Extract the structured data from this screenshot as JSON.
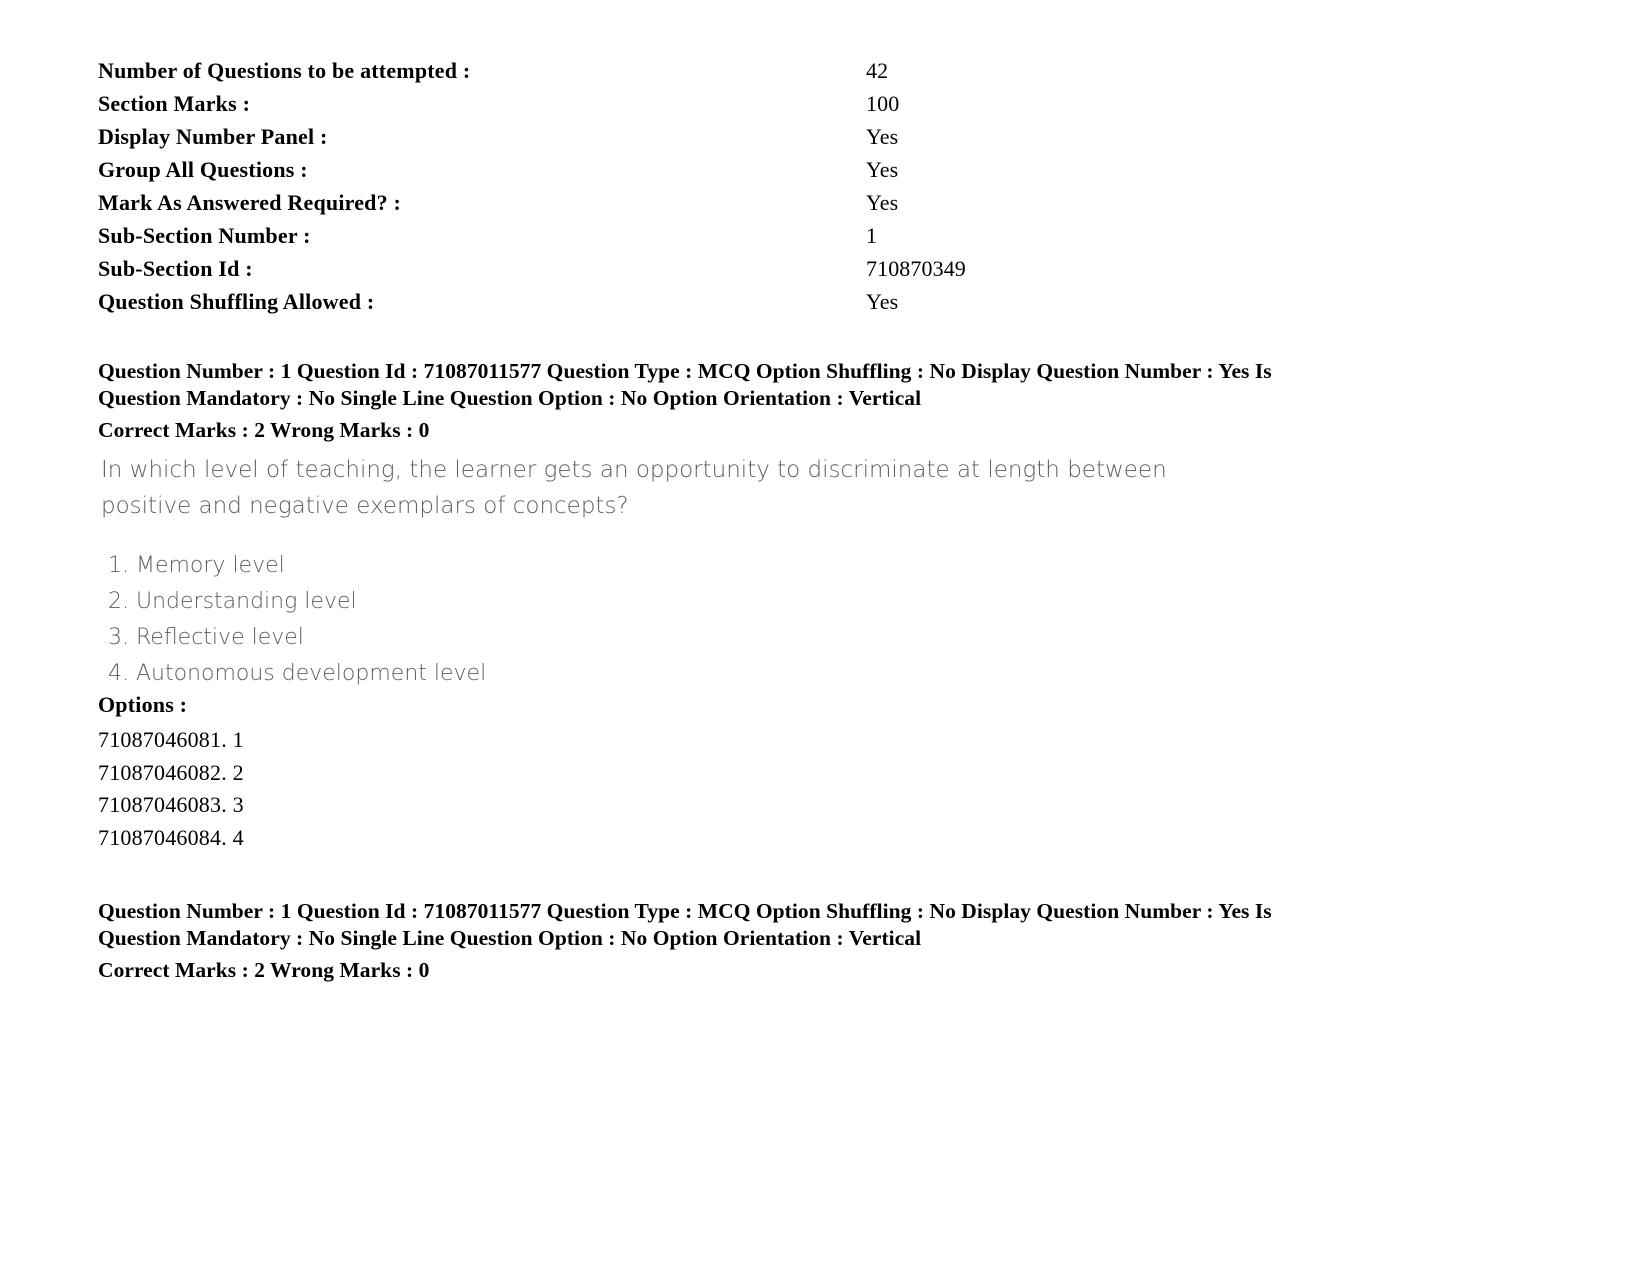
{
  "section_info": {
    "rows": [
      {
        "label": "Number of Questions to be attempted :",
        "value": "42"
      },
      {
        "label": "Section Marks :",
        "value": "100"
      },
      {
        "label": "Display Number Panel :",
        "value": "Yes"
      },
      {
        "label": "Group All Questions :",
        "value": "Yes"
      },
      {
        "label": "Mark As Answered Required? :",
        "value": "Yes"
      },
      {
        "label": "Sub-Section Number :",
        "value": "1"
      },
      {
        "label": "Sub-Section Id :",
        "value": "710870349"
      },
      {
        "label": "Question Shuffling Allowed :",
        "value": "Yes"
      }
    ]
  },
  "question_meta": {
    "line1": "Question Number : 1 Question Id : 71087011577 Question Type : MCQ Option Shuffling : No Display Question Number : Yes Is",
    "line2": "Question Mandatory : No Single Line Question Option : No Option Orientation : Vertical",
    "marks_line": "Correct Marks : 2 Wrong Marks : 0"
  },
  "question": {
    "text_line1": "In which level of teaching, the learner gets an opportunity to discriminate at length between",
    "text_line2": "positive and negative exemplars of concepts?",
    "choices": [
      "1. Memory level",
      "2. Understanding level",
      "3. Reflective level",
      "4. Autonomous development level"
    ],
    "options_heading": "Options :",
    "option_ids": [
      "71087046081. 1",
      "71087046082. 2",
      "71087046083. 3",
      "71087046084. 4"
    ]
  },
  "question_meta_repeat": {
    "line1": "Question Number : 1 Question Id : 71087011577 Question Type : MCQ Option Shuffling : No Display Question Number : Yes Is",
    "line2": "Question Mandatory : No Single Line Question Option : No Option Orientation : Vertical",
    "marks_line": "Correct Marks : 2 Wrong Marks : 0"
  }
}
